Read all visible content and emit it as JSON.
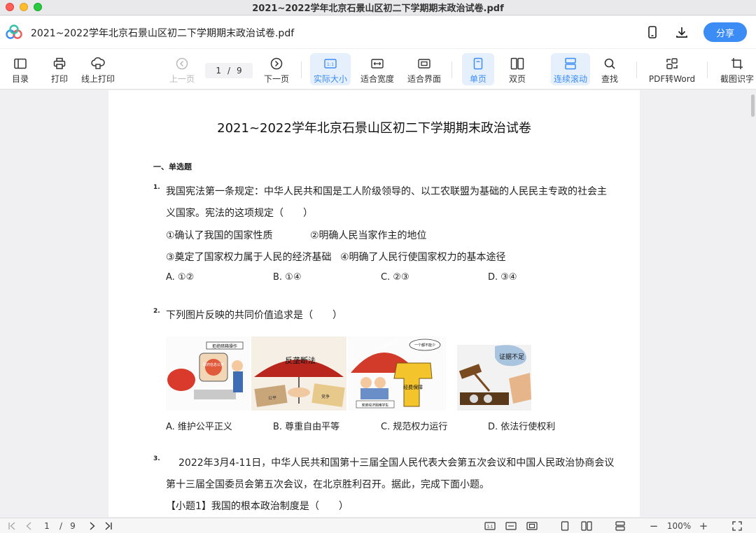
{
  "window": {
    "title": "2021~2022学年北京石景山区初二下学期期末政治试卷.pdf"
  },
  "header": {
    "file_name": "2021~2022学年北京石景山区初二下学期期末政治试卷.pdf",
    "share_label": "分享"
  },
  "toolbar": {
    "toc": "目录",
    "print": "打印",
    "online_print": "线上打印",
    "prev_page": "上一页",
    "current_page": "1",
    "page_sep": "/",
    "total_pages": "9",
    "next_page": "下一页",
    "actual_size": "实际大小",
    "fit_width": "适合宽度",
    "fit_window": "适合界面",
    "single_page": "单页",
    "double_page": "双页",
    "continuous": "连续滚动",
    "find": "查找",
    "pdf_to_word": "PDF转Word",
    "screenshot_ocr": "截图识字",
    "accent": "#3b8cf5"
  },
  "document": {
    "title": "2021~2022学年北京石景山区初二下学期期末政治试卷",
    "section": "一、单选题",
    "q1": {
      "num": "1.",
      "line1": "我国宪法第一条规定：中华人民共和国是工人阶级领导的、以工农联盟为基础的人民民主专政的社会主",
      "line2": "义国家。宪法的这项规定（　　）",
      "s1": "①确认了我国的国家性质",
      "s2": "②明确人民当家作主的地位",
      "s3": "③奠定了国家权力属于人民的经济基础",
      "s4": "④明确了人民行使国家权力的基本途径",
      "options": [
        "A. ①②",
        "B. ①④",
        "C. ②③",
        "D. ③④"
      ]
    },
    "q2": {
      "num": "2.",
      "line1": "下列图片反映的共同价值追求是（　　）",
      "pic_labels": [
        "拒绝暗箱操作",
        "政府信息公开",
        "反垄断法",
        "公平",
        "竞争",
        "学生资助政策",
        "一个都不能少",
        "经费保障",
        "家庭经济困难学生",
        "证据不足"
      ],
      "options": [
        "A. 维护公平正义",
        "B. 尊重自由平等",
        "C. 规范权力运行",
        "D. 依法行使权利"
      ]
    },
    "q3": {
      "num": "3.",
      "line1": "2022年3月4-11日，中华人民共和国第十三届全国人民代表大会第五次会议和中国人民政治协商会议",
      "line2": "第十三届全国委员会第五次会议，在北京胜利召开。据此，完成下面小题。",
      "line3": "【小题1】我国的根本政治制度是（　　）"
    }
  },
  "bottom": {
    "current_page": "1",
    "sep": "/",
    "total": "9",
    "zoom": "100%",
    "minus": "−",
    "plus": "+"
  }
}
